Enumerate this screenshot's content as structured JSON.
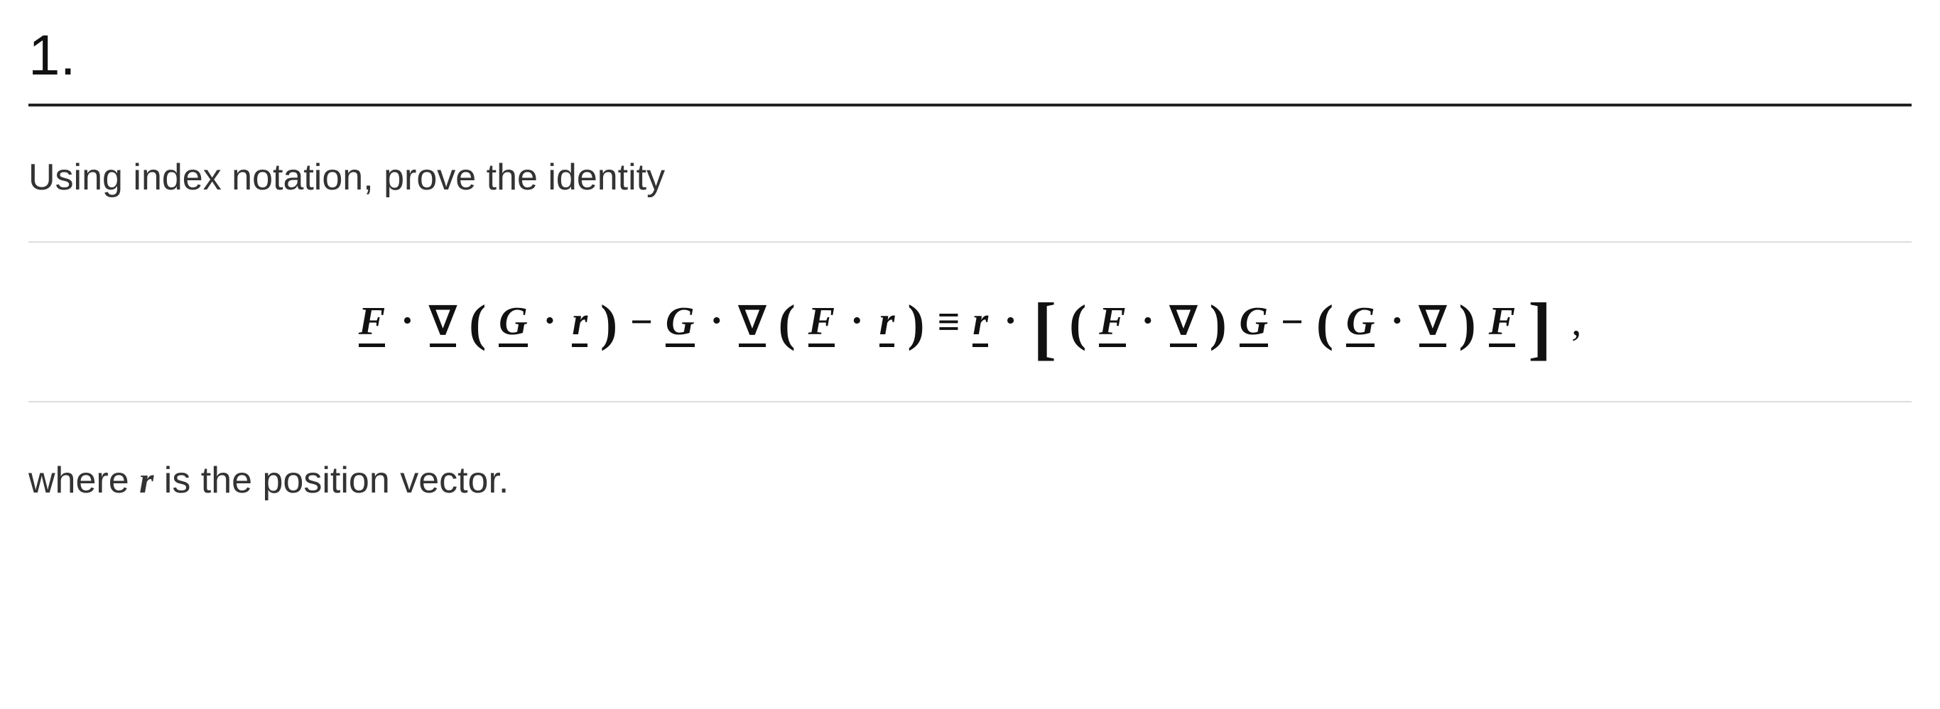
{
  "problem": {
    "number": "1.",
    "prompt": "Using index notation, prove the identity",
    "eq": {
      "F": "F",
      "G": "G",
      "r": "r",
      "nabla": "∇",
      "dot": "·",
      "minus": "−",
      "equiv": "≡",
      "lparen": "(",
      "rparen": ")",
      "lbrack": "[",
      "rbrack": "]",
      "comma": ","
    },
    "after_pre": "where ",
    "after_sym": "r",
    "after_post": " is the position vector."
  }
}
